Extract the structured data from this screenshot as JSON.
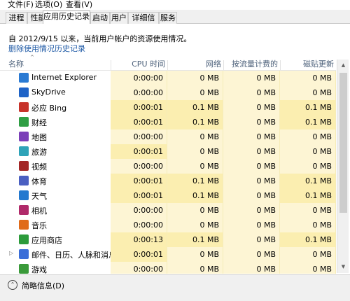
{
  "menu": [
    "文件(F)",
    "选项(O)",
    "查看(V)"
  ],
  "tabs": [
    "进程",
    "性能",
    "应用历史记录",
    "启动",
    "用户",
    "详细信息",
    "服务"
  ],
  "active_tab": 2,
  "info_text": "自 2012/9/15 以来，当前用户帐户的资源使用情况。",
  "delete_link": "删除使用情况历史记录",
  "columns": {
    "name": "名称",
    "cpu": "CPU 时间",
    "network": "网络",
    "metered": "按流量计费的网...",
    "tile": "磁贴更新"
  },
  "rows": [
    {
      "name": "Internet Explorer",
      "icon": "internet-explorer-icon",
      "color": "#2a7ad3",
      "cpu": "0:00:00",
      "network": "0 MB",
      "metered": "0 MB",
      "tile": "0 MB"
    },
    {
      "name": "SkyDrive",
      "icon": "skydrive-icon",
      "color": "#1e63c7",
      "cpu": "0:00:00",
      "network": "0 MB",
      "metered": "0 MB",
      "tile": "0 MB"
    },
    {
      "name": "必应 Bing",
      "icon": "bing-icon",
      "color": "#c7322a",
      "cpu": "0:00:01",
      "network": "0.1 MB",
      "metered": "0 MB",
      "tile": "0.1 MB"
    },
    {
      "name": "财经",
      "icon": "finance-icon",
      "color": "#2f9e44",
      "cpu": "0:00:01",
      "network": "0.1 MB",
      "metered": "0 MB",
      "tile": "0.1 MB"
    },
    {
      "name": "地图",
      "icon": "maps-icon",
      "color": "#7b3fb8",
      "cpu": "0:00:00",
      "network": "0 MB",
      "metered": "0 MB",
      "tile": "0 MB"
    },
    {
      "name": "旅游",
      "icon": "travel-icon",
      "color": "#2ea3b8",
      "cpu": "0:00:01",
      "network": "0 MB",
      "metered": "0 MB",
      "tile": "0 MB"
    },
    {
      "name": "视频",
      "icon": "video-icon",
      "color": "#a32626",
      "cpu": "0:00:00",
      "network": "0 MB",
      "metered": "0 MB",
      "tile": "0 MB"
    },
    {
      "name": "体育",
      "icon": "sports-icon",
      "color": "#4a5fc1",
      "cpu": "0:00:01",
      "network": "0.1 MB",
      "metered": "0 MB",
      "tile": "0.1 MB"
    },
    {
      "name": "天气",
      "icon": "weather-icon",
      "color": "#2479cf",
      "cpu": "0:00:01",
      "network": "0.1 MB",
      "metered": "0 MB",
      "tile": "0.1 MB"
    },
    {
      "name": "相机",
      "icon": "camera-icon",
      "color": "#b02a6a",
      "cpu": "0:00:00",
      "network": "0 MB",
      "metered": "0 MB",
      "tile": "0 MB"
    },
    {
      "name": "音乐",
      "icon": "music-icon",
      "color": "#e06b1a",
      "cpu": "0:00:00",
      "network": "0 MB",
      "metered": "0 MB",
      "tile": "0 MB"
    },
    {
      "name": "应用商店",
      "icon": "store-icon",
      "color": "#2c9b3b",
      "cpu": "0:00:13",
      "network": "0.1 MB",
      "metered": "0 MB",
      "tile": "0.1 MB"
    },
    {
      "name": "邮件、日历、人脉和消息...",
      "icon": "mail-calendar-people-icon",
      "color": "#3a6ed8",
      "cpu": "0:00:01",
      "network": "0 MB",
      "metered": "0 MB",
      "tile": "0 MB"
    },
    {
      "name": "游戏",
      "icon": "games-icon",
      "color": "#3a9a3a",
      "cpu": "0:00:00",
      "network": "0 MB",
      "metered": "0 MB",
      "tile": "0 MB"
    }
  ],
  "footer_label": "简略信息(D)",
  "colors": {
    "heat_light": "#fdf5d4",
    "heat_medium": "#fbeeb0",
    "header_text": "#4c607a",
    "link": "#1f5aa6"
  }
}
